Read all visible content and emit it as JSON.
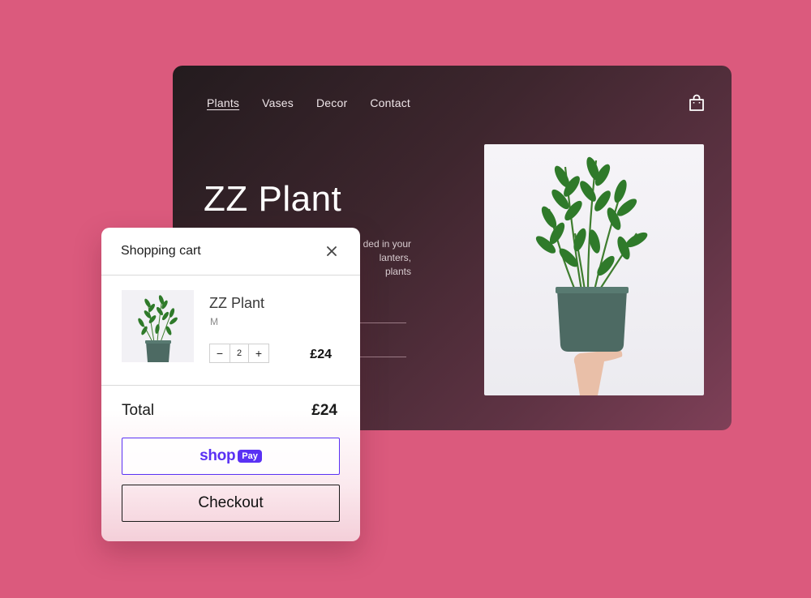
{
  "store": {
    "nav": [
      "Plants",
      "Vases",
      "Decor",
      "Contact"
    ],
    "active_nav": "Plants",
    "hero_title": "ZZ Plant",
    "hero_desc_lines": [
      "ded in your",
      "lanters,",
      "plants"
    ],
    "icons": {
      "cart": "shopping-bag-icon"
    }
  },
  "cart": {
    "title": "Shopping cart",
    "close_icon": "close-icon",
    "item": {
      "name": "ZZ Plant",
      "variant": "M",
      "quantity": "2",
      "minus": "−",
      "plus": "+",
      "price": "£24"
    },
    "total_label": "Total",
    "total_value": "£24",
    "shop_pay": {
      "shop": "shop",
      "pay": "Pay"
    },
    "checkout_label": "Checkout"
  },
  "colors": {
    "background": "#db5a7d",
    "shop_pay_purple": "#5a31f4",
    "pot": "#4d6a63",
    "leaf": "#2f7a2a"
  }
}
